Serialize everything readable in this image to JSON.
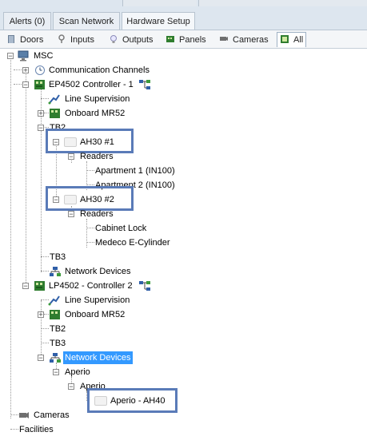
{
  "top_tabs": [
    {
      "label": "Alerts (0)"
    },
    {
      "label": "Scan Network"
    },
    {
      "label": "Hardware Setup",
      "active": true
    }
  ],
  "sub_tabs": [
    {
      "label": "Doors",
      "icon": "door-icon"
    },
    {
      "label": "Inputs",
      "icon": "input-icon"
    },
    {
      "label": "Outputs",
      "icon": "bulb-icon"
    },
    {
      "label": "Panels",
      "icon": "panel-icon"
    },
    {
      "label": "Cameras",
      "icon": "camera-icon"
    },
    {
      "label": "All",
      "icon": "all-icon",
      "active": true
    }
  ],
  "tree": {
    "root": "MSC",
    "comm_channels": "Communication Channels",
    "ctrl1": "EP4502 Controller - 1",
    "line_sup_1": "Line Supervision",
    "onboard_1": "Onboard MR52",
    "tb2_1": "TB2",
    "ah30_1": "AH30 #1",
    "readers_1": "Readers",
    "apt1": "Apartment 1 (IN100)",
    "apt2": "Apartment 2 (IN100)",
    "ah30_2": "AH30 #2",
    "readers_2": "Readers",
    "cabinet": "Cabinet Lock",
    "medeco": "Medeco E-Cylinder",
    "tb3_1": "TB3",
    "netdev_1": "Network Devices",
    "ctrl2": "LP4502 - Controller 2",
    "line_sup_2": "Line Supervision",
    "onboard_2": "Onboard MR52",
    "tb2_2": "TB2",
    "tb3_2": "TB3",
    "netdev_2": "Network Devices",
    "aperio_1": "Aperio",
    "aperio_2": "Aperio",
    "aperio_ah40": "Aperio - AH40",
    "cameras": "Cameras",
    "facilities": "Facilities"
  },
  "colors": {
    "selection": "#3399ff",
    "highlight_border": "#5a7bb8"
  }
}
